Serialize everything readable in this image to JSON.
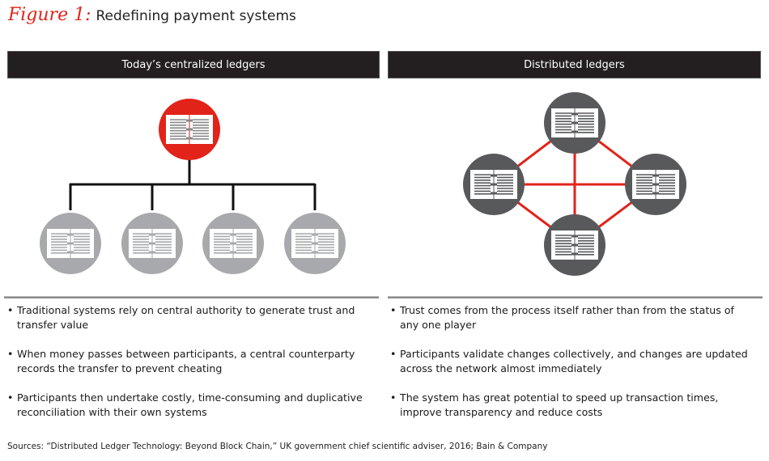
{
  "title": {
    "figure_label": "Figure 1:",
    "text": "Redefining payment systems"
  },
  "colors": {
    "accent_red": "#e2231a",
    "dark_header": "#231f20",
    "node_gray_light": "#a7a9ac",
    "node_gray_dark": "#58595b",
    "connector_black": "#111111"
  },
  "panels": {
    "left": {
      "header": "Today’s centralized ledgers",
      "diagram": {
        "type": "hierarchy",
        "central_node": {
          "icon": "ledger-book-icon",
          "color": "red"
        },
        "child_nodes": [
          {
            "icon": "ledger-book-icon",
            "color": "light-gray"
          },
          {
            "icon": "ledger-book-icon",
            "color": "light-gray"
          },
          {
            "icon": "ledger-book-icon",
            "color": "light-gray"
          },
          {
            "icon": "ledger-book-icon",
            "color": "light-gray"
          }
        ]
      },
      "bullets": [
        "Traditional systems rely on central authority to generate trust and transfer value",
        "When money passes between participants, a central counterparty records the transfer to prevent cheating",
        "Participants then undertake costly, time-consuming and duplicative reconciliation with their own systems"
      ]
    },
    "right": {
      "header": "Distributed ledgers",
      "diagram": {
        "type": "mesh",
        "nodes": [
          {
            "id": "top",
            "icon": "ledger-book-icon",
            "color": "dark-gray"
          },
          {
            "id": "left",
            "icon": "ledger-book-icon",
            "color": "dark-gray"
          },
          {
            "id": "right",
            "icon": "ledger-book-icon",
            "color": "dark-gray"
          },
          {
            "id": "bottom",
            "icon": "ledger-book-icon",
            "color": "dark-gray"
          }
        ],
        "links": [
          [
            "top",
            "left"
          ],
          [
            "top",
            "right"
          ],
          [
            "top",
            "bottom"
          ],
          [
            "left",
            "right"
          ],
          [
            "left",
            "bottom"
          ],
          [
            "right",
            "bottom"
          ]
        ]
      },
      "bullets": [
        "Trust comes from the process itself rather than from the status of any one player",
        "Participants validate changes collectively, and changes are updated across the network almost immediately",
        "The system has great potential to speed up transaction times, improve transparency and reduce costs"
      ]
    }
  },
  "source": "Sources: “Distributed Ledger Technology: Beyond Block Chain,” UK government chief scientific adviser, 2016; Bain & Company"
}
